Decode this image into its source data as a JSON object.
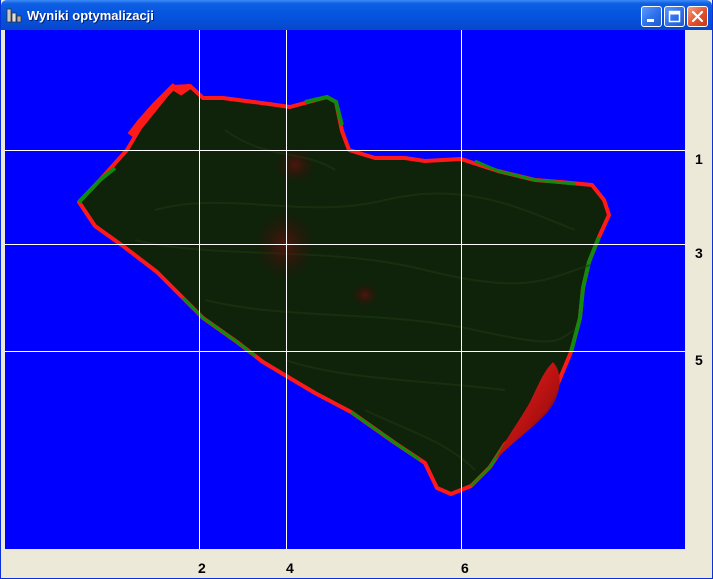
{
  "window": {
    "title": "Wyniki optymalizacji"
  },
  "titlebar_buttons": {
    "minimize": "minimize-icon",
    "maximize": "maximize-icon",
    "close": "close-icon"
  },
  "colors": {
    "background": "#0000FF",
    "grid": "#FFFFFF",
    "region": "#0F220A",
    "edge_red": "#FF1A1A",
    "edge_green": "#118A11"
  },
  "axis_labels": {
    "right": [
      "1",
      "3",
      "5"
    ],
    "bottom": [
      "2",
      "4",
      "6"
    ]
  }
}
